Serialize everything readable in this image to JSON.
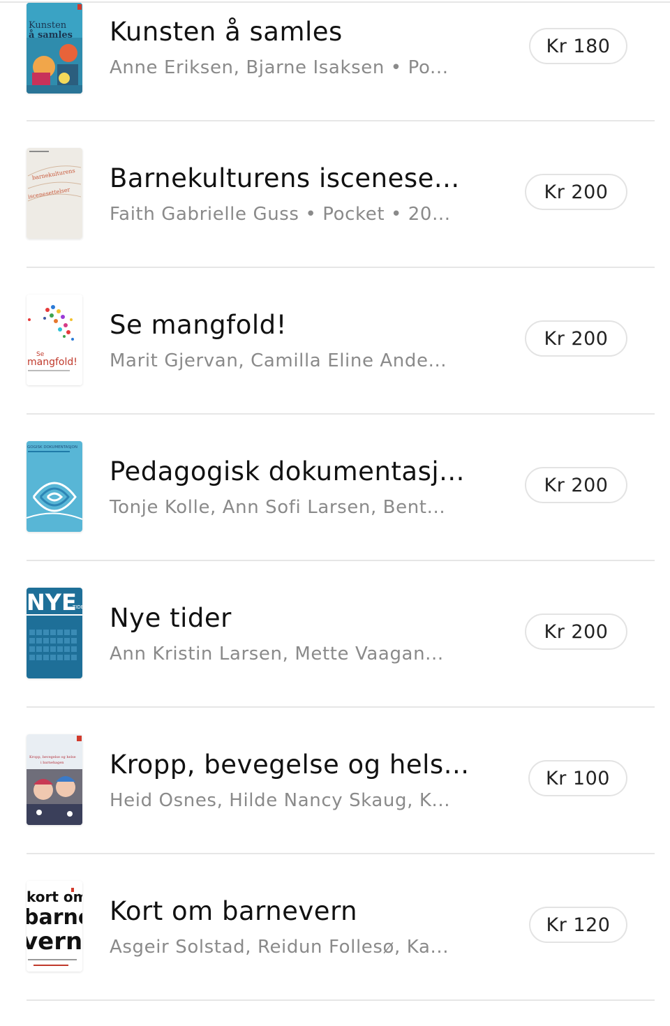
{
  "books": [
    {
      "title": "Kunsten å samles",
      "subtitle": "Anne Eriksen, Bjarne Isaksen • Po...",
      "price": "Kr 180",
      "cover_text": [
        "Kunsten",
        "å samles"
      ],
      "cover_icon": "book-cover-kunsten-a-samles"
    },
    {
      "title": "Barnekulturens iscenese...",
      "subtitle": "Faith Gabrielle Guss • Pocket • 20...",
      "price": "Kr 200",
      "cover_text": [
        "barnekulturens",
        "iscenesettelser"
      ],
      "cover_icon": "book-cover-barnekulturens"
    },
    {
      "title": "Se mangfold!",
      "subtitle": "Marit Gjervan, Camilla Eline Ande...",
      "price": "Kr 200",
      "cover_text": [
        "Se",
        "mangfold!"
      ],
      "cover_icon": "book-cover-se-mangfold"
    },
    {
      "title": "Pedagogisk dokumentasj...",
      "subtitle": "Tonje Kolle, Ann Sofi Larsen, Bent...",
      "price": "Kr 200",
      "cover_text": [
        "GOGISK DOKUMENTASJON"
      ],
      "cover_icon": "book-cover-pedagogisk-dokumentasjon"
    },
    {
      "title": "Nye tider",
      "subtitle": "Ann Kristin Larsen, Mette Vaagan...",
      "price": "Kr 200",
      "cover_text": [
        "NYE",
        "TIDER"
      ],
      "cover_icon": "book-cover-nye-tider"
    },
    {
      "title": "Kropp, bevegelse og hels...",
      "subtitle": "Heid Osnes, Hilde Nancy Skaug, K...",
      "price": "Kr 100",
      "cover_text": [
        "Kropp, bevegelse og helse",
        "i barnehagen"
      ],
      "cover_icon": "book-cover-kropp-bevegelse"
    },
    {
      "title": "Kort om barnevern",
      "subtitle": "Asgeir Solstad, Reidun Follesø, Ka...",
      "price": "Kr 120",
      "cover_text": [
        "kort om",
        "barne",
        "vern"
      ],
      "cover_icon": "book-cover-kort-om-barnevern"
    }
  ]
}
